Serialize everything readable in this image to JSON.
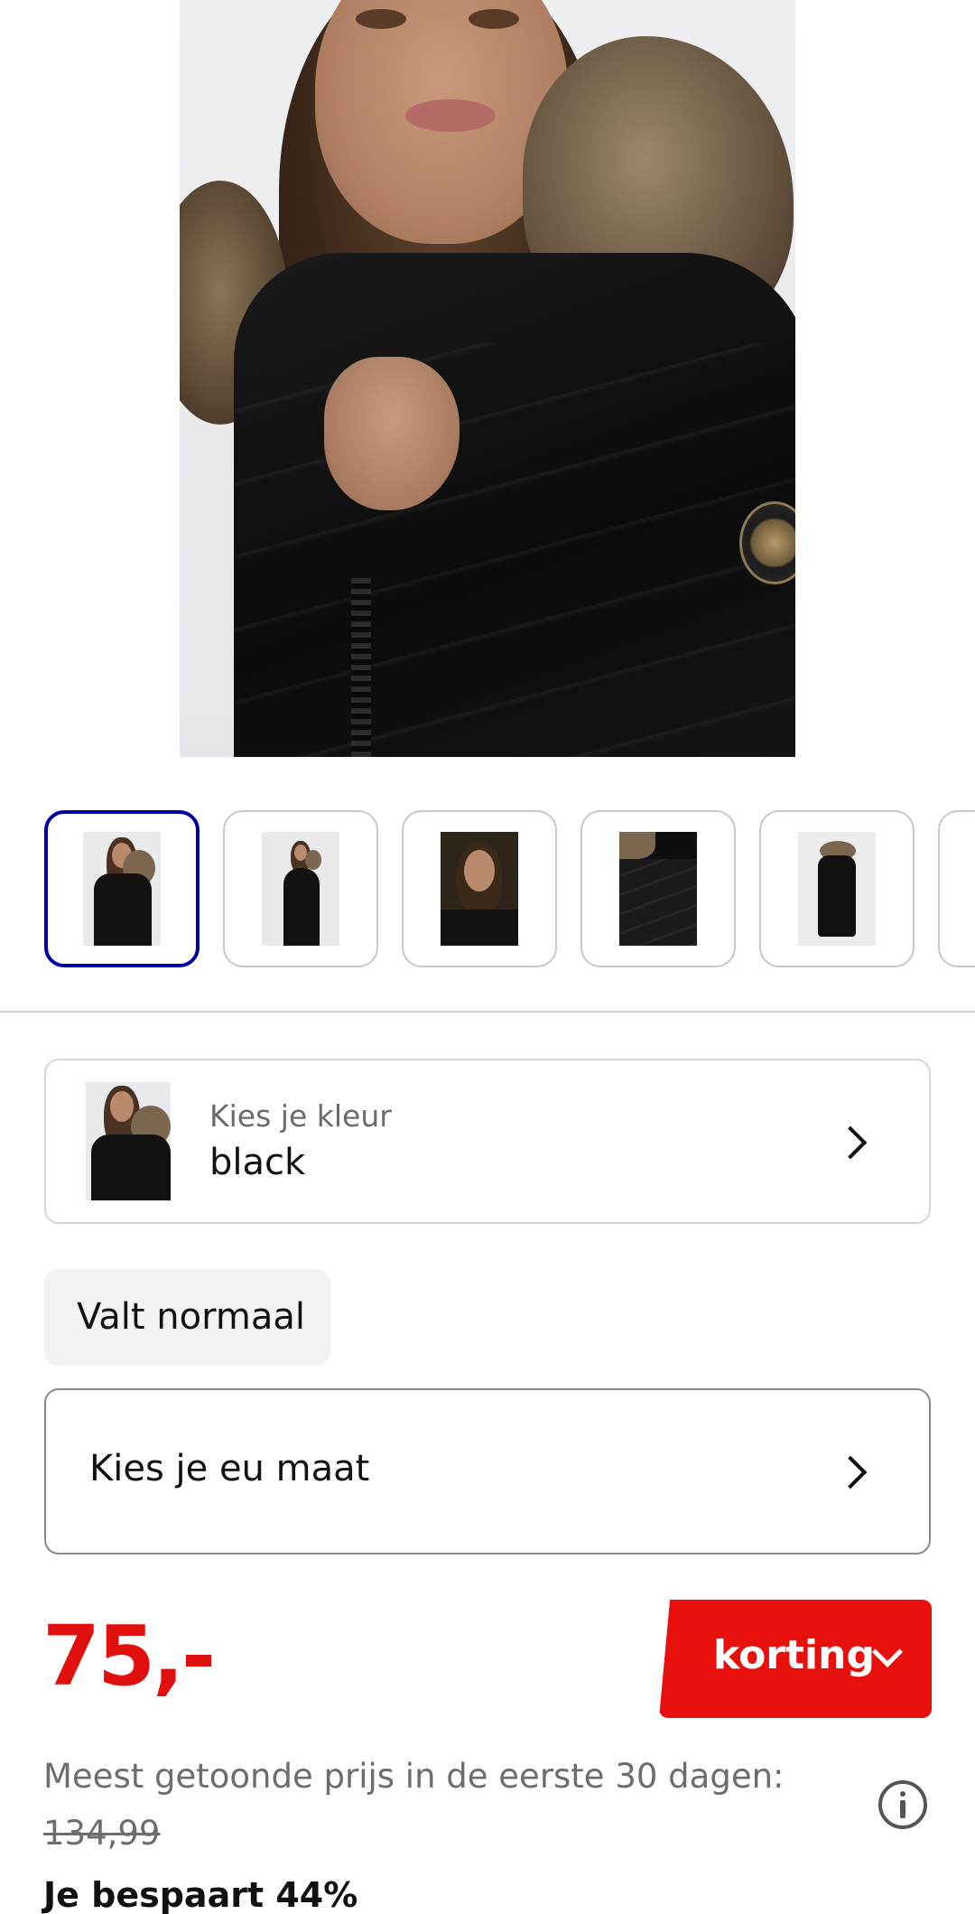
{
  "gallery": {
    "main_image": "product-photo-woman-black-puffer-coat-fur-hood",
    "thumbnails": [
      {
        "name": "thumb-1",
        "style": "closeup",
        "selected": true
      },
      {
        "name": "thumb-2",
        "style": "full",
        "selected": false
      },
      {
        "name": "thumb-3",
        "style": "hood",
        "selected": false
      },
      {
        "name": "thumb-4",
        "style": "detail",
        "selected": false
      },
      {
        "name": "thumb-5",
        "style": "product",
        "selected": false
      },
      {
        "name": "thumb-6",
        "style": "product",
        "selected": false
      }
    ]
  },
  "color_picker": {
    "label": "Kies je kleur",
    "value": "black",
    "icon": "chevron-right-icon"
  },
  "fit_tag": "Valt normaal",
  "size_picker": {
    "label": "Kies je eu maat",
    "icon": "chevron-right-icon"
  },
  "pricing": {
    "price": "75,-",
    "discount_button": "korting",
    "reference_label": "Meest getoonde prijs in de eerste 30 dagen:",
    "reference_price": "134,99",
    "savings": "Je bespaart 44%"
  },
  "colors": {
    "accent": "#e8100c",
    "selected_border": "#0000a4"
  }
}
